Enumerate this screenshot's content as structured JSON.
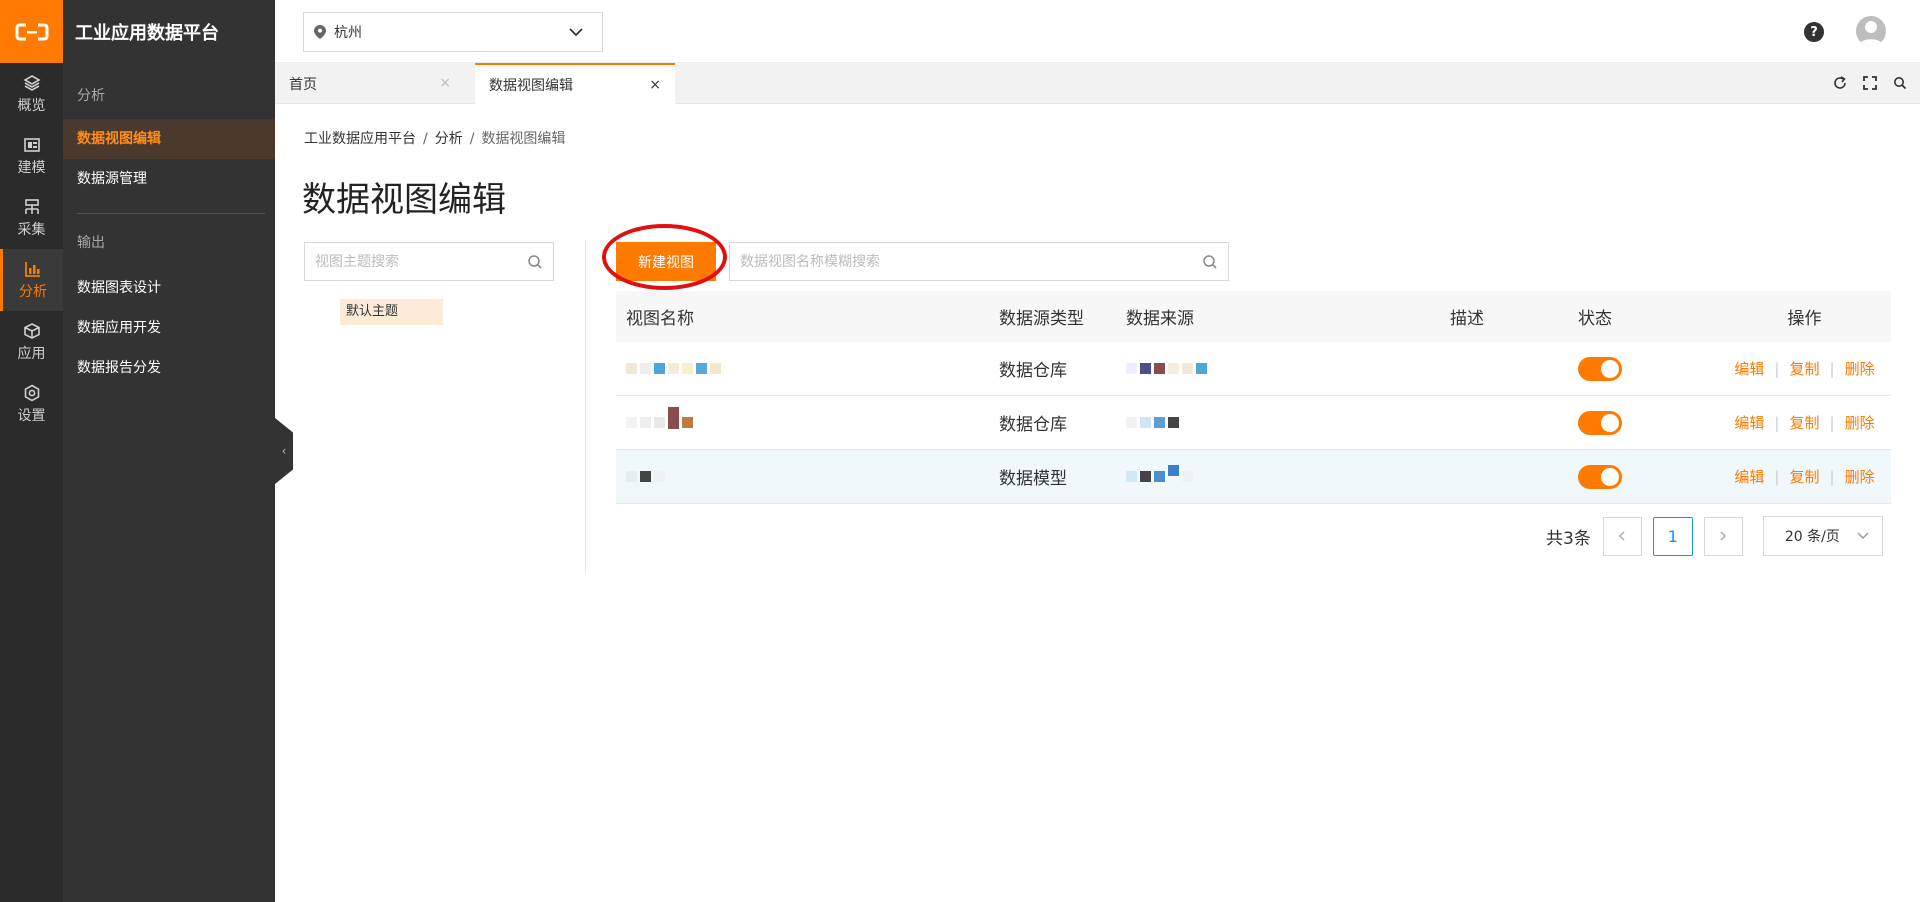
{
  "app": {
    "brand_title": "工业应用数据平台"
  },
  "rail": {
    "items": [
      {
        "label": "概览",
        "icon": "layers-icon"
      },
      {
        "label": "建模",
        "icon": "model-icon"
      },
      {
        "label": "采集",
        "icon": "collect-icon"
      },
      {
        "label": "分析",
        "icon": "chart-icon",
        "active": true
      },
      {
        "label": "应用",
        "icon": "cube-icon"
      },
      {
        "label": "设置",
        "icon": "settings-icon"
      }
    ]
  },
  "sidebar": {
    "group1_title": "分析",
    "group1_items": [
      "数据视图编辑",
      "数据源管理"
    ],
    "group2_title": "输出",
    "group2_items": [
      "数据图表设计",
      "数据应用开发",
      "数据报告分发"
    ]
  },
  "topbar": {
    "city": "杭州",
    "help": "?"
  },
  "tabs": [
    {
      "label": "首页",
      "close": "×"
    },
    {
      "label": "数据视图编辑",
      "close": "×",
      "active": true
    }
  ],
  "breadcrumb": [
    "工业数据应用平台",
    "分析",
    "数据视图编辑"
  ],
  "breadcrumb_sep": "/",
  "page_title": "数据视图编辑",
  "topic_search": {
    "placeholder": "视图主题搜索"
  },
  "topic_tag": "默认主题",
  "new_button": "新建视图",
  "view_search": {
    "placeholder": "数据视图名称模糊搜索"
  },
  "table": {
    "headers": [
      "视图名称",
      "数据源类型",
      "数据来源",
      "描述",
      "状态",
      "操作"
    ],
    "rows": [
      {
        "source_type": "数据仓库",
        "enabled": true
      },
      {
        "source_type": "数据仓库",
        "enabled": true
      },
      {
        "source_type": "数据模型",
        "enabled": true
      }
    ],
    "actions": [
      "编辑",
      "复制",
      "删除"
    ],
    "action_sep": "|"
  },
  "pagination": {
    "total": "共3条",
    "current": "1",
    "page_size": "20 条/页"
  },
  "colors": {
    "accent": "#ff7a00",
    "sidebar": "#333333",
    "rail": "#2b2b2b",
    "highlight_ring": "#e01010",
    "page_active": "#1890ff"
  }
}
